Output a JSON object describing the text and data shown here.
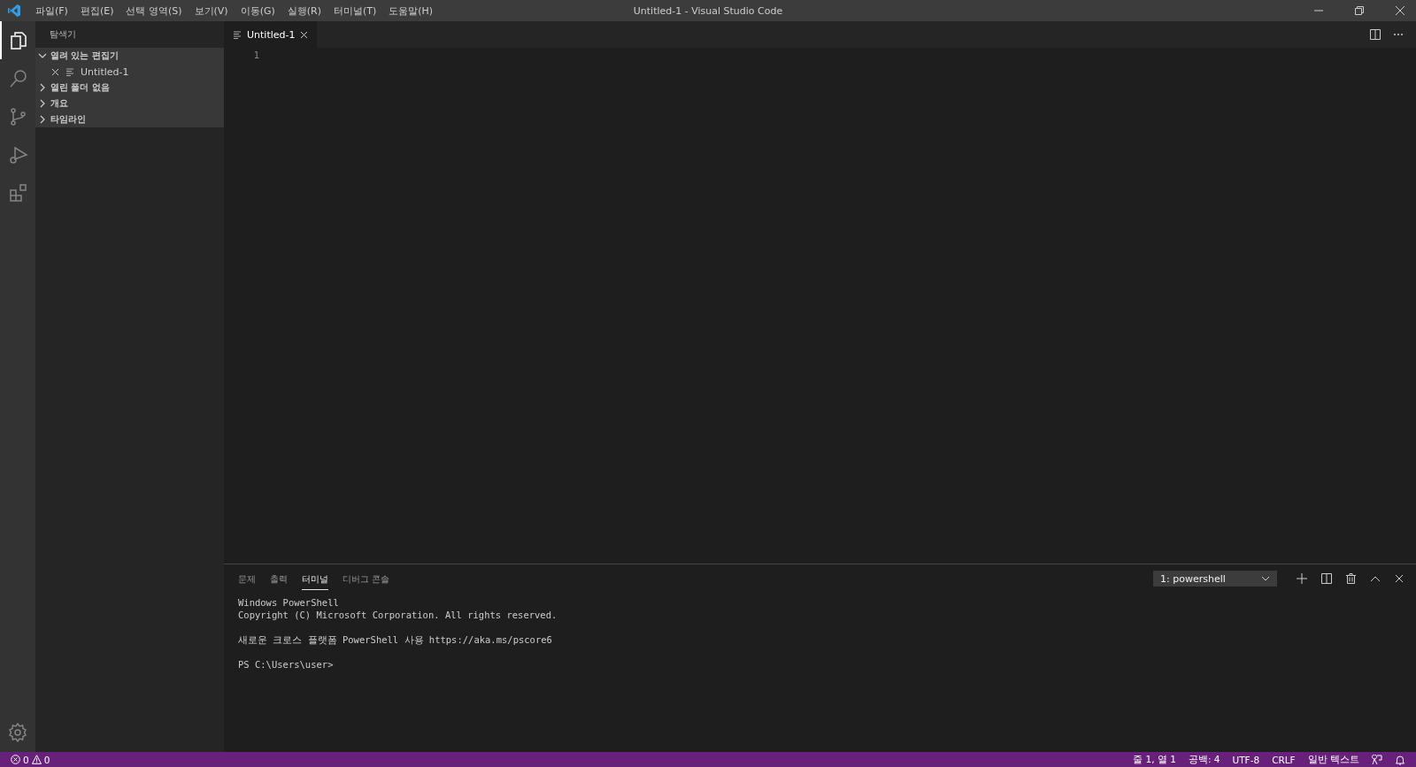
{
  "window": {
    "title": "Untitled-1 - Visual Studio Code"
  },
  "menu": [
    "파일(F)",
    "편집(E)",
    "선택 영역(S)",
    "보기(V)",
    "이동(G)",
    "실행(R)",
    "터미널(T)",
    "도움말(H)"
  ],
  "activity_bar": [
    {
      "kind": "files",
      "selected": true
    },
    {
      "kind": "search",
      "selected": false
    },
    {
      "kind": "branch",
      "selected": false
    },
    {
      "kind": "debug",
      "selected": false
    },
    {
      "kind": "extensions",
      "selected": false
    }
  ],
  "sidebar": {
    "title": "탐색기",
    "sections": [
      {
        "label": "열려 있는 편집기",
        "expanded": true,
        "items": [
          "Untitled-1"
        ]
      },
      {
        "label": "열린 폴더 없음",
        "expanded": false
      },
      {
        "label": "개요",
        "expanded": false
      },
      {
        "label": "타임라인",
        "expanded": false
      }
    ]
  },
  "editor_tabs": [
    {
      "label": "Untitled-1",
      "selected": true
    }
  ],
  "editor": {
    "line_numbers": [
      "1"
    ]
  },
  "panel": {
    "tabs": [
      {
        "label": "문제",
        "selected": false
      },
      {
        "label": "출력",
        "selected": false
      },
      {
        "label": "터미널",
        "selected": true
      },
      {
        "label": "디버그 콘솔",
        "selected": false
      }
    ],
    "terminal_select": "1: powershell",
    "terminal_blocks": [
      [
        "Windows PowerShell",
        "Copyright (C) Microsoft Corporation. All rights reserved."
      ],
      [
        "새로운 크로스 플랫폼 PowerShell 사용 https://aka.ms/pscore6"
      ],
      [
        "PS C:\\Users\\user>"
      ]
    ]
  },
  "status_bar": {
    "errors": "0",
    "warnings": "0",
    "right": [
      "줄 1, 열 1",
      "공백: 4",
      "UTF-8",
      "CRLF",
      "일반 텍스트"
    ]
  }
}
